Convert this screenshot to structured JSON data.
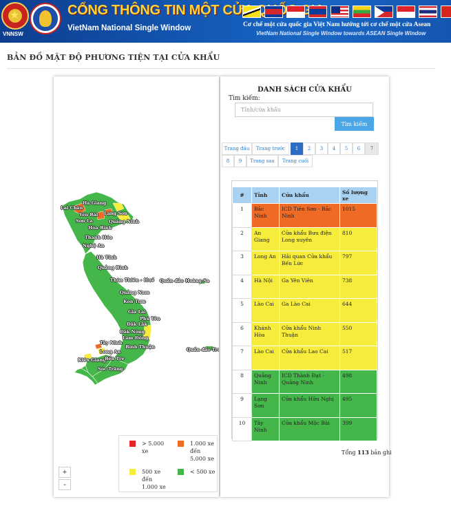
{
  "banner": {
    "logo_text": "VNNSW",
    "title": "CỔNG THÔNG TIN MỘT CỬA QUỐC GIA",
    "subtitle": "VietNam National Single Window",
    "tagline_vi": "Cơ chế một cửa quốc gia Việt Nam hướng tới cơ chế một cửa Asean",
    "tagline_en": "VietNam National Single Window towards ASEAN Single Window",
    "flags": [
      "brunei-flag",
      "cambodia-flag",
      "indonesia-flag",
      "laos-flag",
      "malaysia-flag",
      "myanmar-flag",
      "philippines-flag",
      "singapore-flag",
      "thailand-flag",
      "vietnam-flag"
    ]
  },
  "page_title": "BẢN ĐỒ MẬT ĐỘ PHƯƠNG TIỆN TẠI CỬA KHẨU",
  "map": {
    "labels": [
      "Hà Giang",
      "Lai Châu",
      "Lạng Sơn",
      "Yên Bái",
      "Sơn La",
      "Quảng Ninh",
      "Hòa Bình",
      "Thanh Hóa",
      "Nghệ An",
      "Hà Tĩnh",
      "Quảng Bình",
      "Thừa Thiên - Huế",
      "Quần đảo Hoàng Sa",
      "Quảng Nam",
      "Kon Tum",
      "Gia Lai",
      "Phú Yên",
      "Đắk Lắk",
      "Đắk Nông",
      "Lâm Đồng",
      "Tây Ninh",
      "Bình Thuận",
      "Long An",
      "Kiên Giang",
      "Bến Tre",
      "Sóc Trăng",
      "Quần đảo Trường Sa"
    ],
    "legend": [
      {
        "label": "> 5.000 xe",
        "color": "#e8242b"
      },
      {
        "label": "1.000 xe đến 5.000 xe",
        "color": "#ef6a25"
      },
      {
        "label": "500 xe đến 1.000 xe",
        "color": "#f7ec3b"
      },
      {
        "label": "< 500 xe",
        "color": "#45b649"
      }
    ],
    "zoom_in": "+",
    "zoom_out": "-"
  },
  "list": {
    "title": "DANH SÁCH CỬA KHẨU",
    "search_label": "Tìm kiếm:",
    "search_placeholder": "Tỉnh/cửa khẩu",
    "search_button": "Tìm kiếm",
    "pager": {
      "first": "Trang đầu",
      "prev": "Trang trước",
      "pages": [
        "1",
        "2",
        "3",
        "4",
        "5",
        "6",
        "7",
        "8",
        "9"
      ],
      "next": "Trang sau",
      "last": "Trang cuối",
      "active_page": "1"
    },
    "columns": [
      "#",
      "Tỉnh",
      "Cửa khẩu",
      "Số lượng xe"
    ],
    "rows": [
      {
        "no": "1",
        "province": "Bắc Ninh",
        "gate": "ICD Tiên Sơn - Bắc Ninh",
        "count": "1015",
        "level": "high"
      },
      {
        "no": "2",
        "province": "An Giang",
        "gate": "Cửa khẩu Bưu điện Long xuyên",
        "count": "810",
        "level": "mid"
      },
      {
        "no": "3",
        "province": "Long An",
        "gate": "Hải quan Cửa khẩu Bến Lức",
        "count": "797",
        "level": "mid"
      },
      {
        "no": "4",
        "province": "Hà Nội",
        "gate": "Ga Yên Viên",
        "count": "738",
        "level": "mid"
      },
      {
        "no": "5",
        "province": "Lào Cai",
        "gate": "Ga Lào Cai",
        "count": "644",
        "level": "mid"
      },
      {
        "no": "6",
        "province": "Khánh Hòa",
        "gate": "Cửa khẩu Ninh Thuận",
        "count": "550",
        "level": "mid"
      },
      {
        "no": "7",
        "province": "Lào Cai",
        "gate": "Cửa khẩu Lao Cai",
        "count": "517",
        "level": "mid"
      },
      {
        "no": "8",
        "province": "Quảng Ninh",
        "gate": "ICD Thành Đạt - Quảng Ninh",
        "count": "498",
        "level": "low"
      },
      {
        "no": "9",
        "province": "Lạng Sơn",
        "gate": "Cửa khẩu Hữu Nghị",
        "count": "495",
        "level": "low"
      },
      {
        "no": "10",
        "province": "Tây Ninh",
        "gate": "Cửa khẩu Mộc Bài",
        "count": "399",
        "level": "low"
      }
    ],
    "total_prefix": "Tổng",
    "total_count": "113",
    "total_suffix": "bản ghi"
  }
}
